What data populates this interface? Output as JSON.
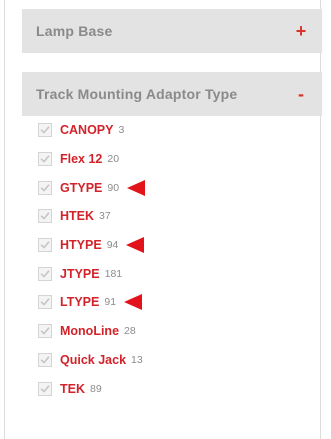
{
  "filters": {
    "lamp_base": {
      "title": "Lamp Base",
      "toggle": "+"
    },
    "track_mounting_adaptor_type": {
      "title": "Track Mounting Adaptor Type",
      "toggle": "-",
      "options": [
        {
          "label": "CANOPY",
          "count": "3",
          "highlighted": false
        },
        {
          "label": "Flex 12",
          "count": "20",
          "highlighted": false
        },
        {
          "label": "GTYPE",
          "count": "90",
          "highlighted": true
        },
        {
          "label": "HTEK",
          "count": "37",
          "highlighted": false
        },
        {
          "label": "HTYPE",
          "count": "94",
          "highlighted": true
        },
        {
          "label": "JTYPE",
          "count": "181",
          "highlighted": false
        },
        {
          "label": "LTYPE",
          "count": "91",
          "highlighted": true
        },
        {
          "label": "MonoLine",
          "count": "28",
          "highlighted": false
        },
        {
          "label": "Quick Jack",
          "count": "13",
          "highlighted": false
        },
        {
          "label": "TEK",
          "count": "89",
          "highlighted": false
        }
      ]
    }
  },
  "colors": {
    "accent_red": "#d2232a",
    "arrow_red": "#e3131b",
    "header_bg": "#e3e3e3",
    "header_text": "#8a8a8a",
    "count_text": "#8c8c8c"
  }
}
